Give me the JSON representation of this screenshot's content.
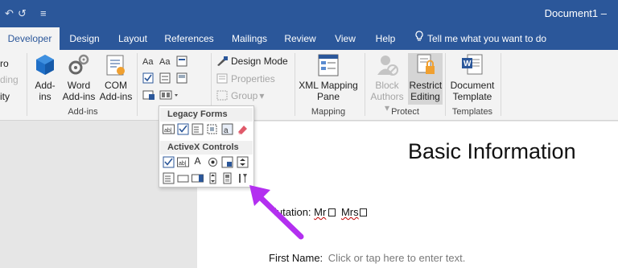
{
  "title_bar": {
    "undo_glyph": "↶",
    "redo_glyph": "↺",
    "customize_glyph": "≡",
    "document_title": "Document1",
    "title_arrow": "–"
  },
  "tabs": [
    {
      "label": "Developer",
      "active": true
    },
    {
      "label": "Design"
    },
    {
      "label": "Layout"
    },
    {
      "label": "References"
    },
    {
      "label": "Mailings"
    },
    {
      "label": "Review"
    },
    {
      "label": "View"
    },
    {
      "label": "Help"
    }
  ],
  "tell_me": "Tell me what you want to do",
  "ribbon": {
    "code_group_cut": [
      "ro",
      "ding",
      "ity"
    ],
    "addins": {
      "addins_label": "Add-ins",
      "word_addins_label": "Word Add-ins",
      "com_addins_label": "COM Add-ins",
      "group_label": "Add-ins"
    },
    "controls": {
      "design_mode_label": "Design Mode",
      "properties_label": "Properties",
      "group_label": "Group",
      "group_caret": "▾"
    },
    "mapping": {
      "xml_label": "XML Mapping Pane",
      "group_label": "Mapping"
    },
    "protect": {
      "block_authors_label": "Block Authors",
      "block_caret": "▾",
      "restrict_editing_label": "Restrict Editing",
      "group_label": "Protect"
    },
    "templates": {
      "document_template_label": "Document Template",
      "group_label": "Templates"
    }
  },
  "dropdown": {
    "legacy_title": "Legacy Forms",
    "activex_title": "ActiveX Controls",
    "activex_label_glyph": "A"
  },
  "document": {
    "heading": "Basic Information",
    "salutation_prefix": "lutation:",
    "mr": "Mr",
    "mrs": "Mrs",
    "first_name_label": "First Name:",
    "first_name_placeholder": "Click or tap here to enter text."
  },
  "colors": {
    "title_bar": "#2b579a",
    "ribbon": "#f3f3f3",
    "arrow": "#b32ff0",
    "word_icon": "#2b579a"
  },
  "icons": [
    "undo-icon",
    "redo-icon",
    "add-ins-icon",
    "word-add-ins-icon",
    "com-add-ins-icon",
    "design-mode-icon",
    "properties-icon",
    "group-icon",
    "xml-mapping-icon",
    "block-authors-icon",
    "restrict-editing-icon",
    "document-template-icon",
    "lightbulb-icon"
  ]
}
